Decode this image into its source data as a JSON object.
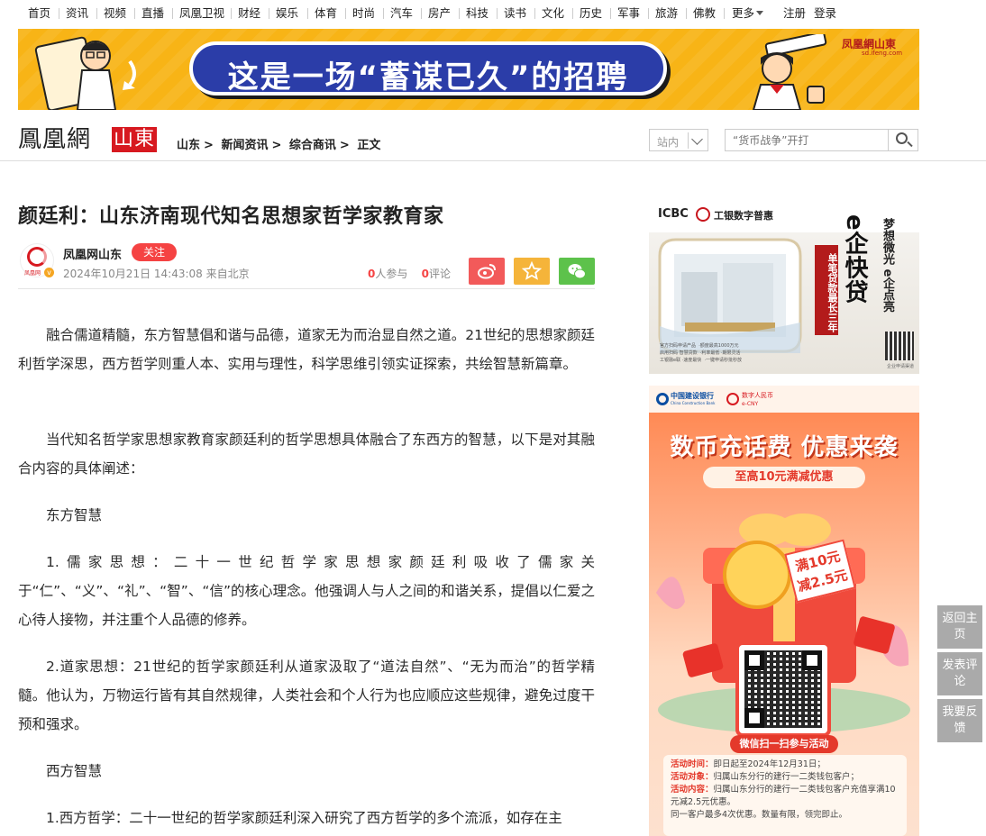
{
  "nav": {
    "items": [
      "首页",
      "资讯",
      "视频",
      "直播",
      "凤凰卫视",
      "财经",
      "娱乐",
      "体育",
      "时尚",
      "汽车",
      "房产",
      "科技",
      "读书",
      "文化",
      "历史",
      "军事",
      "旅游",
      "佛教"
    ],
    "more": "更多",
    "register": "注册",
    "login": "登录"
  },
  "banner": {
    "slogan": "这是一场“蓄谋已久”的招聘",
    "brand": "凤凰網山東",
    "brand_sub": "sd.ifeng.com"
  },
  "header": {
    "logo_main": "鳳凰網",
    "logo_region": "山東",
    "breadcrumb": [
      "山东",
      "新闻资讯",
      "综合商讯",
      "正文"
    ],
    "breadcrumb_sep": ">",
    "site_select": "站内",
    "search_placeholder": "“货币战争”开打"
  },
  "article": {
    "title": "颜廷利：山东济南现代知名思想家哲学家教育家",
    "author": "凤凰网山东",
    "follow": "关注",
    "avatar_text": "凤凰网",
    "meta": "2024年10月21日 14:43:08 来自北京",
    "participants_count": "0",
    "participants_label": "人参与",
    "comments_count": "0",
    "comments_label": "评论",
    "paragraphs": [
      "融合儒道精髓，东方智慧倡和谐与品德，道家无为而治显自然之道。21世纪的思想家颜廷利哲学深思，西方哲学则重人本、实用与理性，科学思维引领实证探索，共绘智慧新篇章。",
      "当代知名哲学家思想家教育家颜廷利的哲学思想具体融合了东西方的智慧，以下是对其融合内容的具体阐述：",
      "东方智慧",
      "1.儒家思想：二十一世纪哲学家思想家颜廷利吸收了儒家关于“仁”、“义”、“礼”、“智”、“信”的核心理念。他强调人与人之间的和谐关系，提倡以仁爱之心待人接物，并注重个人品德的修养。",
      "2.道家思想：21世纪的哲学家颜廷利从道家汲取了“道法自然”、“无为而治”的哲学精髓。他认为，万物运行皆有其自然规律，人类社会和个人行为也应顺应这些规律，避免过度干预和强求。",
      "西方智慧",
      "1.西方哲学：二十一世纪的哲学家颜廷利深入研究了西方哲学的多个流派，如存在主"
    ]
  },
  "ad1": {
    "bank": "ICBC",
    "bank_cn": "工银数字普惠",
    "product": "e企快贷",
    "slogan": "梦想微光 e企点亮",
    "tag": "单笔贷款最长三年",
    "qr_note": "企业申请渠道",
    "fine_1": "官方扫码申请产品",
    "fine_2": "·额度最高1000万元",
    "fine_3": "启用扫码 智慧贷款",
    "fine_4": "·利率最低 ·期限灵活",
    "fine_5": "工银融e联 ·速度最快",
    "fine_6": "·一键申请秒批秒放"
  },
  "ad2": {
    "bank": "中国建设银行",
    "bank_en": "China Construction Bank",
    "ecny": "数字人民币",
    "ecny_en": "e-CNY",
    "headline": "数币充话费 优惠来袭",
    "sub": "至高10元满减优惠",
    "tag_line1": "满10元",
    "tag_line2": "减2.5元",
    "scan": "微信扫一扫参与活动",
    "rules": [
      {
        "k": "活动时间：",
        "v": "即日起至2024年12月31日；"
      },
      {
        "k": "活动对象：",
        "v": "归属山东分行的建行一二类钱包客户；"
      },
      {
        "k": "活动内容：",
        "v": "归属山东分行的建行一二类钱包客户充值享满10元减2.5元优惠。"
      },
      {
        "k": "",
        "v": "同一客户最多4次优惠。数量有限，领完即止。"
      }
    ]
  },
  "float": {
    "back_home": "返回主页",
    "comment": "发表评论",
    "feedback": "我要反馈"
  }
}
